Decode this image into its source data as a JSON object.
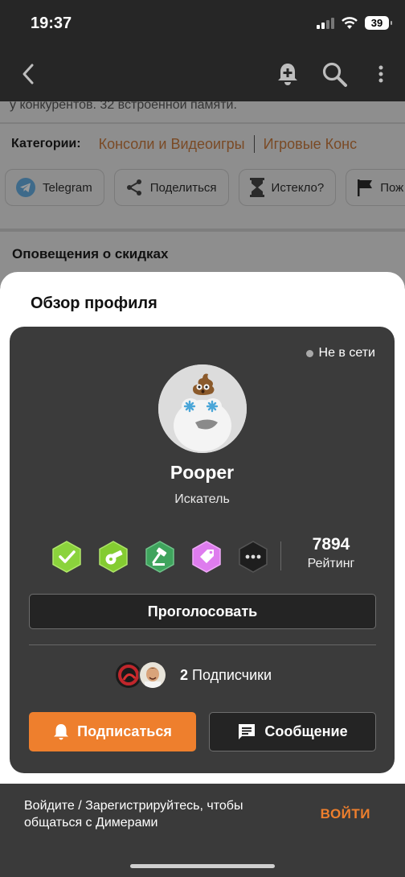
{
  "status_bar": {
    "time": "19:37",
    "battery": "39"
  },
  "background_page": {
    "text_line": "у конкурентов. 32 встроенной памяти.",
    "categories_label": "Категории:",
    "categories": [
      "Консоли и Видеоигры",
      "Игровые Конс"
    ],
    "actions": [
      "Telegram",
      "Поделиться",
      "Истекло?",
      "Пож"
    ],
    "section_title": "Оповещения о скидках"
  },
  "sheet": {
    "title": "Обзор профиля",
    "online_status": "Не в сети",
    "username": "Pooper",
    "rank": "Искатель",
    "badges": [
      {
        "icon": "check-badge",
        "color": "#8bd33c"
      },
      {
        "icon": "whistle-badge",
        "color": "#84cc31"
      },
      {
        "icon": "gavel-badge",
        "color": "#3fa45d"
      },
      {
        "icon": "tag-badge",
        "color": "#de7cee"
      },
      {
        "icon": "more-badge",
        "color": "#1e1e1e"
      }
    ],
    "rating_value": "7894",
    "rating_label": "Рейтинг",
    "vote_button": "Проголосовать",
    "followers_count": "2",
    "followers_label": "Подписчики",
    "subscribe_button": "Подписаться",
    "message_button": "Сообщение"
  },
  "login": {
    "text": "Войдите / Зарегистрируйтесь, чтобы общаться с Димерами",
    "button": "ВОЙТИ"
  },
  "colors": {
    "accent": "#ee7f2d",
    "card": "#3b3b3b",
    "nav": "#262626"
  }
}
